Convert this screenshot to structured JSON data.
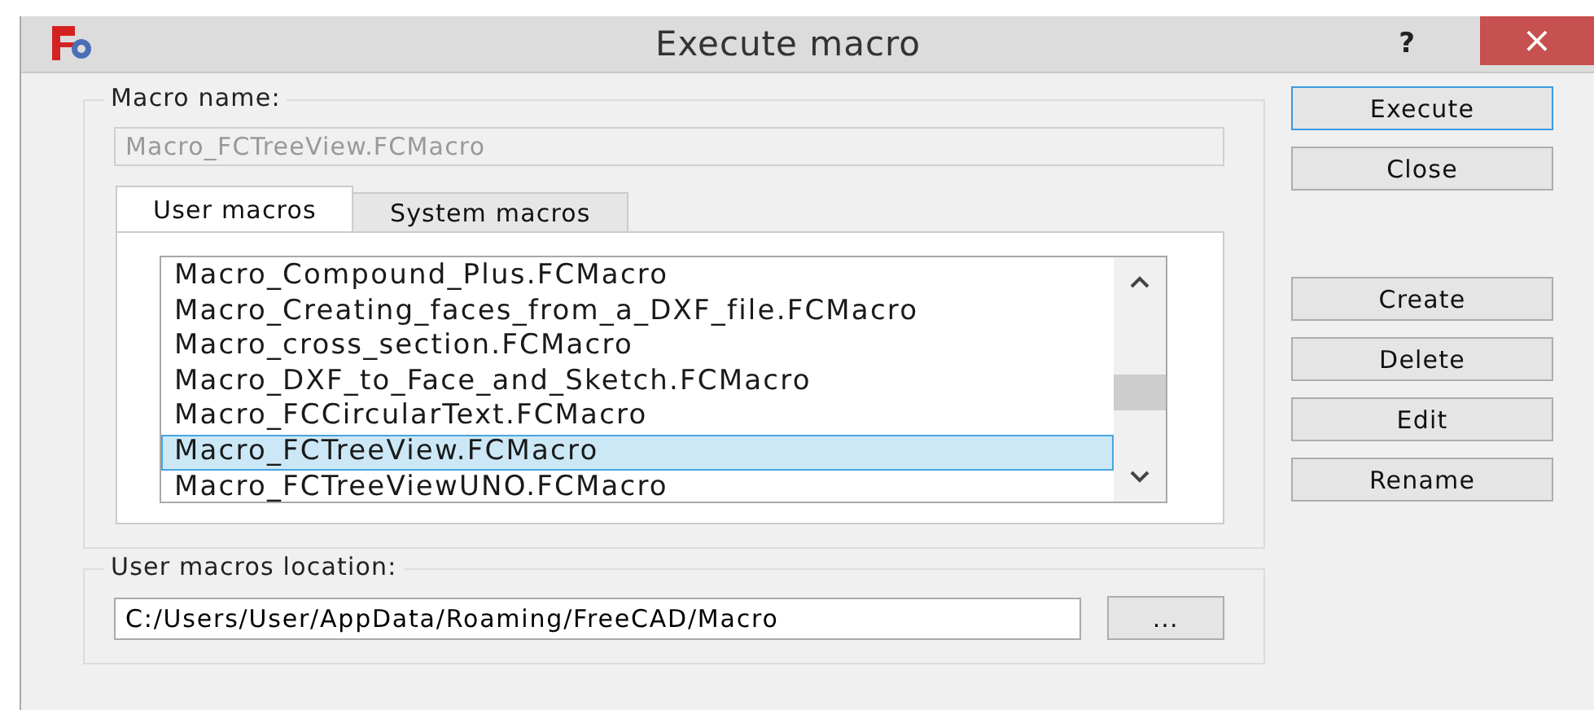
{
  "window": {
    "title": "Execute macro",
    "help": "?",
    "close": "×"
  },
  "macro_name": {
    "label": "Macro name:",
    "value": "Macro_FCTreeView.FCMacro",
    "disabled": true
  },
  "tabs": [
    {
      "label": "User macros",
      "selected": true
    },
    {
      "label": "System macros",
      "selected": false
    }
  ],
  "macros": [
    {
      "name": "Macro_Compound_Plus.FCMacro",
      "selected": false
    },
    {
      "name": "Macro_Creating_faces_from_a_DXF_file.FCMacro",
      "selected": false
    },
    {
      "name": "Macro_cross_section.FCMacro",
      "selected": false
    },
    {
      "name": "Macro_DXF_to_Face_and_Sketch.FCMacro",
      "selected": false
    },
    {
      "name": "Macro_FCCircularText.FCMacro",
      "selected": false
    },
    {
      "name": "Macro_FCTreeView.FCMacro",
      "selected": true
    },
    {
      "name": "Macro_FCTreeViewUNO.FCMacro",
      "selected": false
    }
  ],
  "location": {
    "label": "User macros location:",
    "value": "C:/Users/User/AppData/Roaming/FreeCAD/Macro",
    "browse": "..."
  },
  "dialog_buttons": [
    {
      "label": "Execute",
      "default": true
    },
    {
      "label": "Close",
      "default": false
    }
  ],
  "macro_buttons": [
    {
      "label": "Create",
      "default": false
    },
    {
      "label": "Delete",
      "default": false
    },
    {
      "label": "Edit",
      "default": false
    },
    {
      "label": "Rename",
      "default": false
    }
  ]
}
